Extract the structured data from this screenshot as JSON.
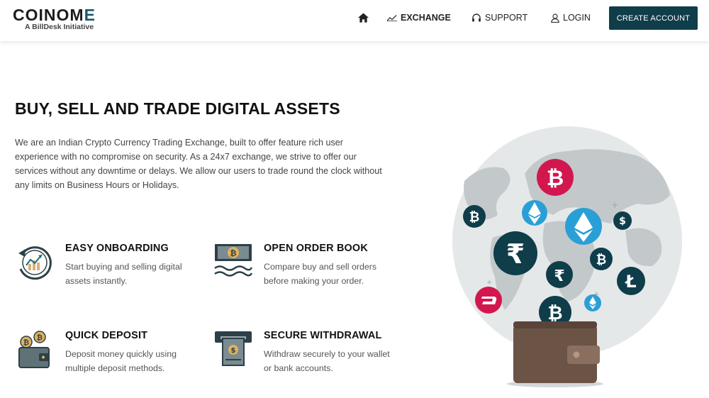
{
  "brand": {
    "name_prefix": "COINOM",
    "name_suffix": "E",
    "tagline": "A BillDesk Initiative",
    "accent": "#1a5968"
  },
  "nav": {
    "exchange": "EXCHANGE",
    "support": "SUPPORT",
    "login": "LOGIN",
    "create_account": "CREATE ACCOUNT"
  },
  "hero": {
    "title": "BUY, SELL AND TRADE DIGITAL ASSETS",
    "description": "We are an Indian Crypto Currency Trading Exchange, built to offer feature rich user experience with no compromise on security. As a 24x7 exchange, we strive to offer our services without any downtime or delays. We allow our users to trade round the clock without any limits on Business Hours or Holidays."
  },
  "features": [
    {
      "title": "EASY ONBOARDING",
      "description": "Start buying and selling digital assets instantly.",
      "icon": "chart-clock-icon"
    },
    {
      "title": "OPEN ORDER BOOK",
      "description": "Compare buy and sell orders before making your order.",
      "icon": "bitcoin-banknote-icon"
    },
    {
      "title": "QUICK DEPOSIT",
      "description": "Deposit money quickly using multiple deposit methods.",
      "icon": "wallet-coins-icon"
    },
    {
      "title": "SECURE WITHDRAWAL",
      "description": "Withdraw securely to your wallet or bank accounts.",
      "icon": "atm-withdrawal-icon"
    }
  ],
  "colors": {
    "primary": "#0f3d4a",
    "crimson": "#d2174f",
    "sky": "#2a9fd6",
    "globe": "#e4e7e8"
  }
}
